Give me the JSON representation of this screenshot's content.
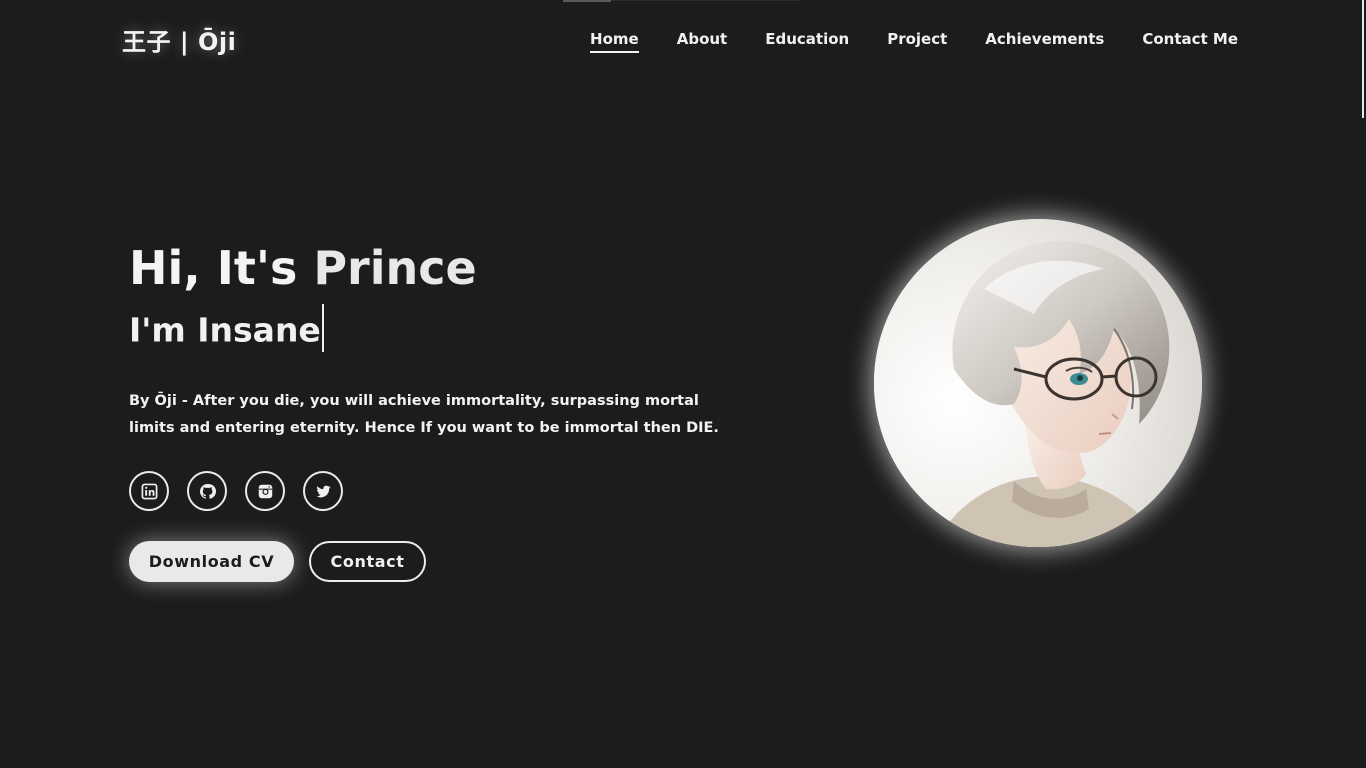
{
  "header": {
    "logo": "王子 | Ōji",
    "nav": [
      {
        "label": "Home",
        "active": true
      },
      {
        "label": "About"
      },
      {
        "label": "Education"
      },
      {
        "label": "Project"
      },
      {
        "label": "Achievements"
      },
      {
        "label": "Contact Me"
      }
    ]
  },
  "hero": {
    "title_prefix": "Hi, It's ",
    "title_name": "Prince",
    "subtitle": "I'm Insane",
    "description": "By Ōji - After you die, you will achieve immortality, surpassing mortal limits and entering eternity. Hence If you want to be immortal then DIE.",
    "socials": [
      {
        "icon": "linkedin-icon"
      },
      {
        "icon": "github-icon"
      },
      {
        "icon": "instagram-icon"
      },
      {
        "icon": "twitter-icon"
      }
    ],
    "buttons": {
      "download": "Download CV",
      "contact": "Contact"
    }
  },
  "colors": {
    "background": "#1c1c1c",
    "text": "#f1f1f1",
    "button_primary_bg": "#e9e9e9"
  },
  "avatar": {
    "icon": "anime-portrait-avatar"
  }
}
